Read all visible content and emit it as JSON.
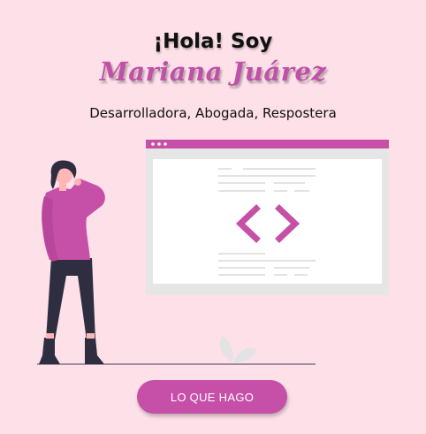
{
  "hero": {
    "greeting": "¡Hola! Soy",
    "name": "Mariana Juárez",
    "roles": "Desarrolladora, Abogada, Respostera",
    "cta_label": "LO QUE HAGO"
  },
  "illustration": {
    "icons": [
      "code-brackets-icon",
      "window-dots-icon",
      "leaf-icon"
    ],
    "colors": {
      "accent": "#c64fa8",
      "window_frame": "#e6e6e6",
      "text_lines": "#d0d0d0",
      "figure_dark": "#2f2e41",
      "background": "#fde0e8"
    }
  }
}
